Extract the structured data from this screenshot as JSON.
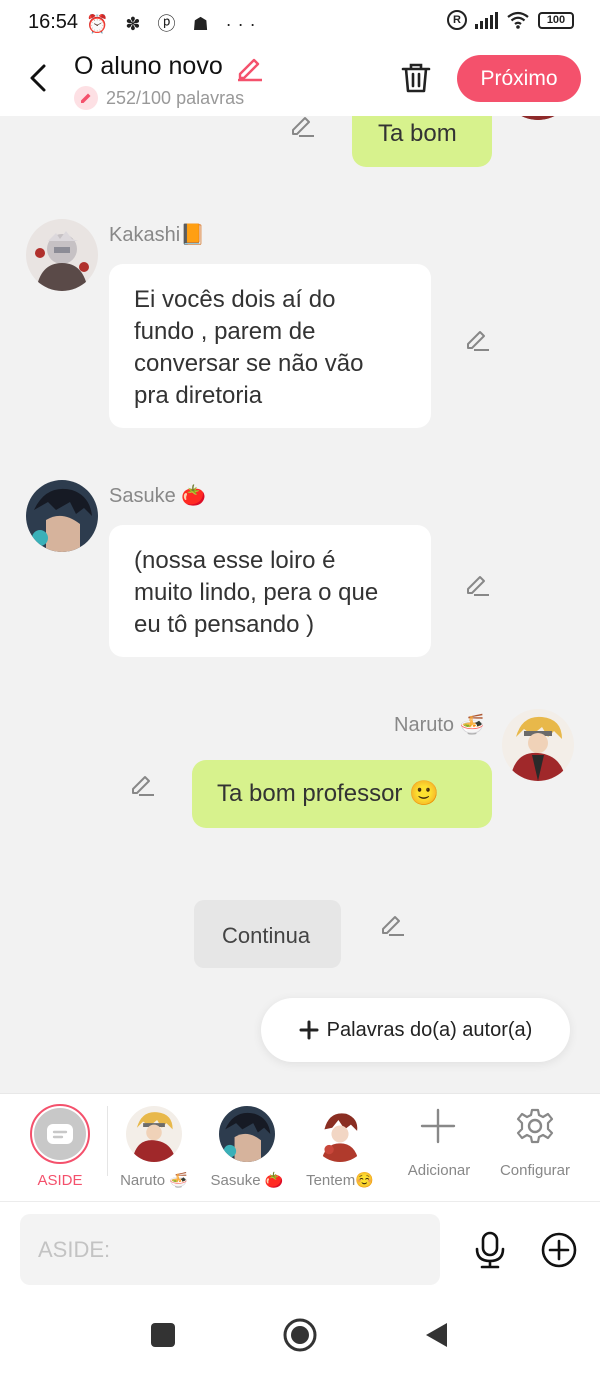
{
  "status_bar": {
    "time": "16:54",
    "notif_icons": "⏰ ✽ ⓟ ☗ ···",
    "r_icon": "R",
    "battery": "100"
  },
  "header": {
    "title": "O aluno novo",
    "word_count": "252/100 palavras",
    "next_label": "Próximo",
    "accent": "#f4516c"
  },
  "chat": {
    "messages": [
      {
        "speaker": "",
        "text": "Ta bom",
        "side": "right"
      },
      {
        "speaker": "Kakashi📙",
        "text": "Ei vocês dois aí do fundo , parem de conversar se não vão pra diretoria",
        "lines": [
          "Ei vocês dois aí do",
          "fundo , parem de",
          "conversar se não vão",
          "pra diretoria"
        ],
        "side": "left"
      },
      {
        "speaker": "Sasuke 🍅",
        "text": "(nossa esse loiro é muito lindo, pera o que eu tô pensando )",
        "lines": [
          "(nossa esse loiro é",
          "muito lindo, pera o que",
          "eu tô pensando )"
        ],
        "side": "left"
      },
      {
        "speaker": "Naruto 🍜",
        "text": "Ta bom professor 🙂",
        "side": "right"
      },
      {
        "speaker": "",
        "text": "Continua",
        "side": "center"
      }
    ],
    "aside_button": "Palavras do(a) autor(a)",
    "green_bubble": "#d7f28d"
  },
  "characters": [
    {
      "label": "ASIDE",
      "active": true
    },
    {
      "label": "Naruto 🍜"
    },
    {
      "label": "Sasuke 🍅"
    },
    {
      "label": "Tentem☺️"
    }
  ],
  "tools": {
    "add_label": "Adicionar",
    "settings_label": "Configurar"
  },
  "input": {
    "placeholder": "ASIDE:"
  }
}
